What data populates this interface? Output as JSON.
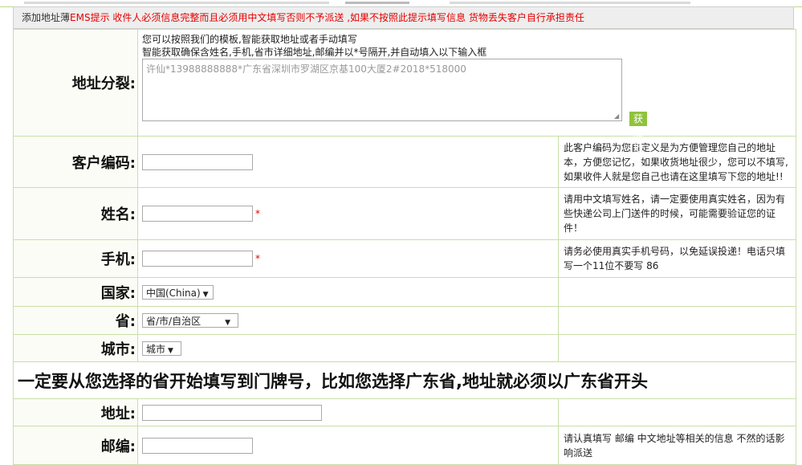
{
  "notice": {
    "prefix": "添加地址薄",
    "ems": "EMS提示",
    "text": " 收件人必须信息完整而且必须用中文填写否则不予派送 ,如果不按照此提示填写信息 货物丢失客户自行承担责任"
  },
  "split": {
    "label": "地址分裂:",
    "hint1": "您可以按照我们的模板,智能获取地址或者手动填写",
    "hint2": "智能获取确保含姓名,手机,省市详细地址,邮编并以*号隔开,并自动填入以下输入框",
    "placeholder": "许仙*13988888888*广东省深圳市罗湖区京基100大厦2#2018*518000",
    "button": "获取地址"
  },
  "customer_code": {
    "label": "客户编码:",
    "tip": "此客户编码为您自定义是为方便管理您自己的地址本，方便您记忆，如果收货地址很少，您可以不填写,如果收件人就是您自己也请在这里填写下您的地址!!"
  },
  "name": {
    "label": "姓名:",
    "star": "*",
    "tip": "请用中文填写姓名，请一定要使用真实姓名，因为有些快递公司上门送件的时候，可能需要验证您的证件！"
  },
  "phone": {
    "label": "手机:",
    "star": "*",
    "tip": "请务必使用真实手机号码，以免延误投递！电话只填写一个11位不要写 86"
  },
  "country": {
    "label": "国家:",
    "selected": "中国(China)"
  },
  "province": {
    "label": "省:",
    "selected": "省/市/自治区"
  },
  "city": {
    "label": "城市:",
    "selected": "城市"
  },
  "warning": "一定要从您选择的省开始填写到门牌号，比如您选择广东省,地址就必须以广东省开头",
  "address": {
    "label": "地址:"
  },
  "zip": {
    "label": "邮编:",
    "tip": "请认真填写 邮编 中文地址等相关的信息 不然的话影响派送"
  },
  "icons": {
    "dropdown": "chevron-down-icon",
    "resize": "resize-grip-icon"
  },
  "colors": {
    "accent_green": "#8fc33c",
    "alert_red": "#e60000",
    "border_green": "#c9dfa8"
  }
}
